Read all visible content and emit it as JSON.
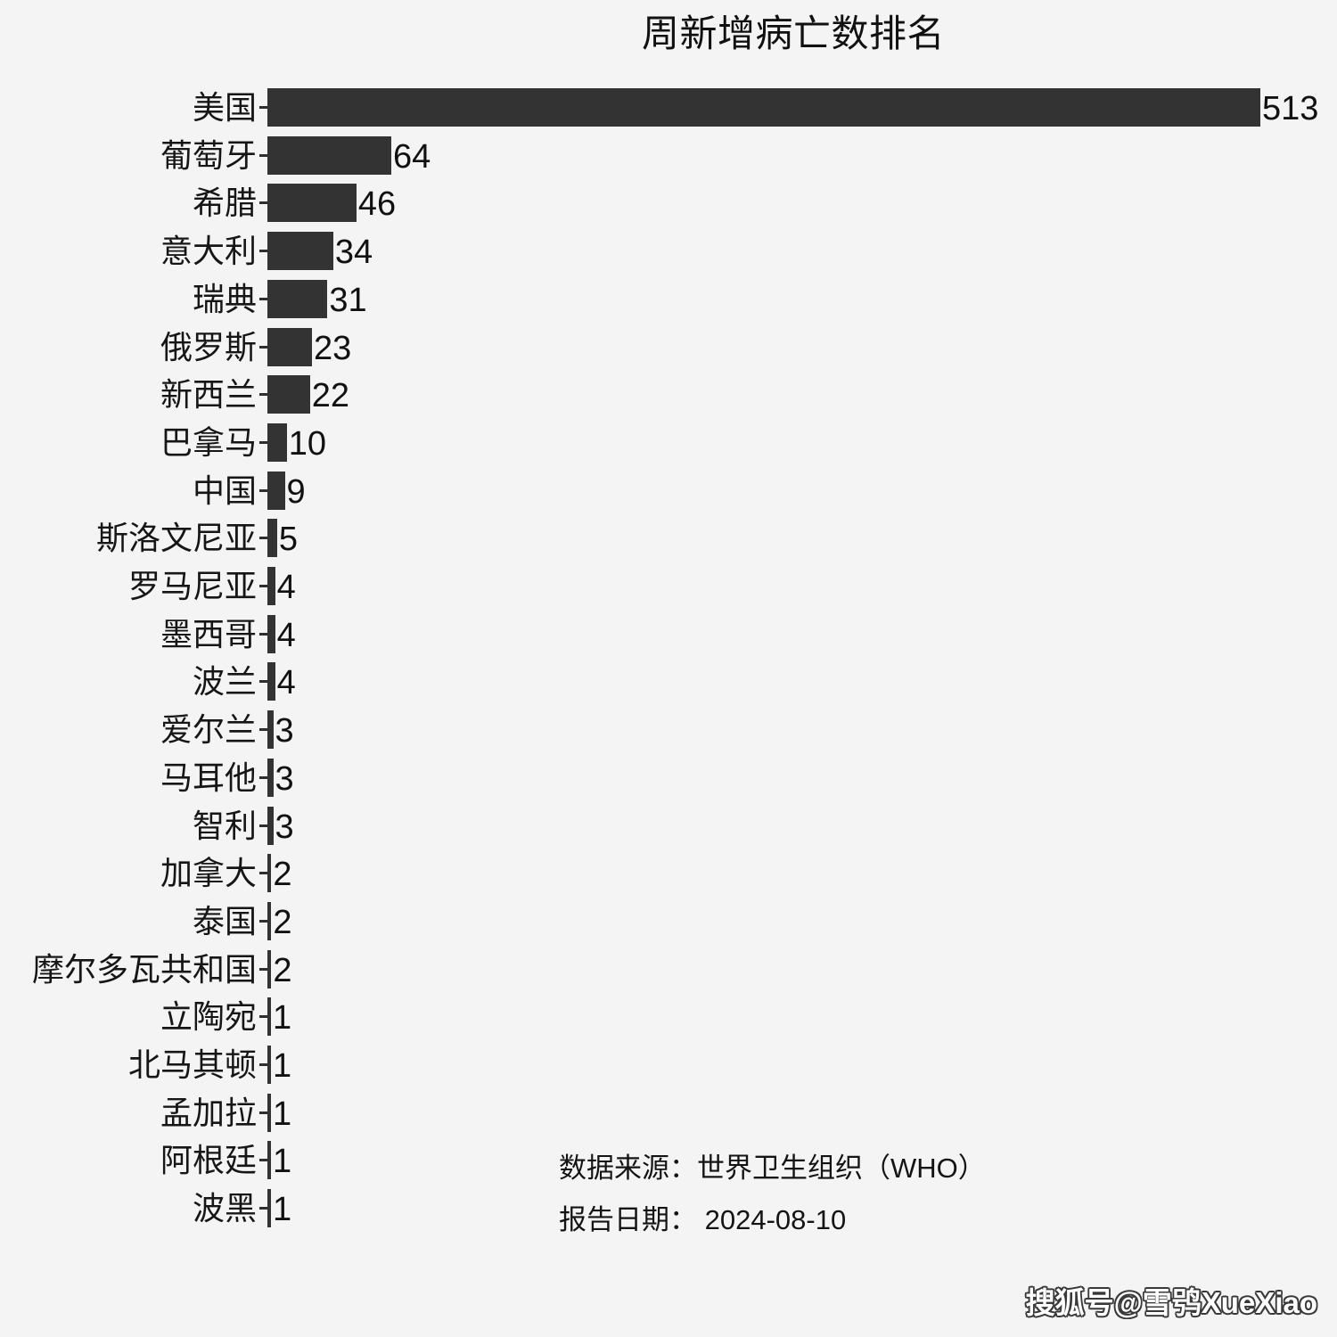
{
  "chart_data": {
    "type": "bar",
    "orientation": "horizontal",
    "title": "周新增病亡数排名",
    "xlabel": "",
    "ylabel": "",
    "grid": false,
    "legend": null,
    "xlim": [
      0,
      513
    ],
    "bar_color": "#333333",
    "background_color": "#f4f4f4",
    "categories": [
      "美国",
      "葡萄牙",
      "希腊",
      "意大利",
      "瑞典",
      "俄罗斯",
      "新西兰",
      "巴拿马",
      "中国",
      "斯洛文尼亚",
      "罗马尼亚",
      "墨西哥",
      "波兰",
      "爱尔兰",
      "马耳他",
      "智利",
      "加拿大",
      "泰国",
      "摩尔多瓦共和国",
      "立陶宛",
      "北马其顿",
      "孟加拉",
      "阿根廷",
      "波黑"
    ],
    "values": [
      513,
      64,
      46,
      34,
      31,
      23,
      22,
      10,
      9,
      5,
      4,
      4,
      4,
      3,
      3,
      3,
      2,
      2,
      2,
      1,
      1,
      1,
      1,
      1
    ],
    "data_labels": [
      "513",
      "64",
      "46",
      "34",
      "31",
      "23",
      "22",
      "10",
      "9",
      "5",
      "4",
      "4",
      "4",
      "3",
      "3",
      "3",
      "2",
      "2",
      "2",
      "1",
      "1",
      "1",
      "1",
      "1"
    ],
    "annotations": [
      "数据来源：世界卫生组织（WHO）",
      "报告日期： 2024-08-10"
    ]
  },
  "footnotes": {
    "source_line": "数据来源：世界卫生组织（WHO）",
    "date_line": "报告日期： 2024-08-10"
  },
  "watermark": {
    "text": "搜狐号@雪鸮XueXiao"
  }
}
